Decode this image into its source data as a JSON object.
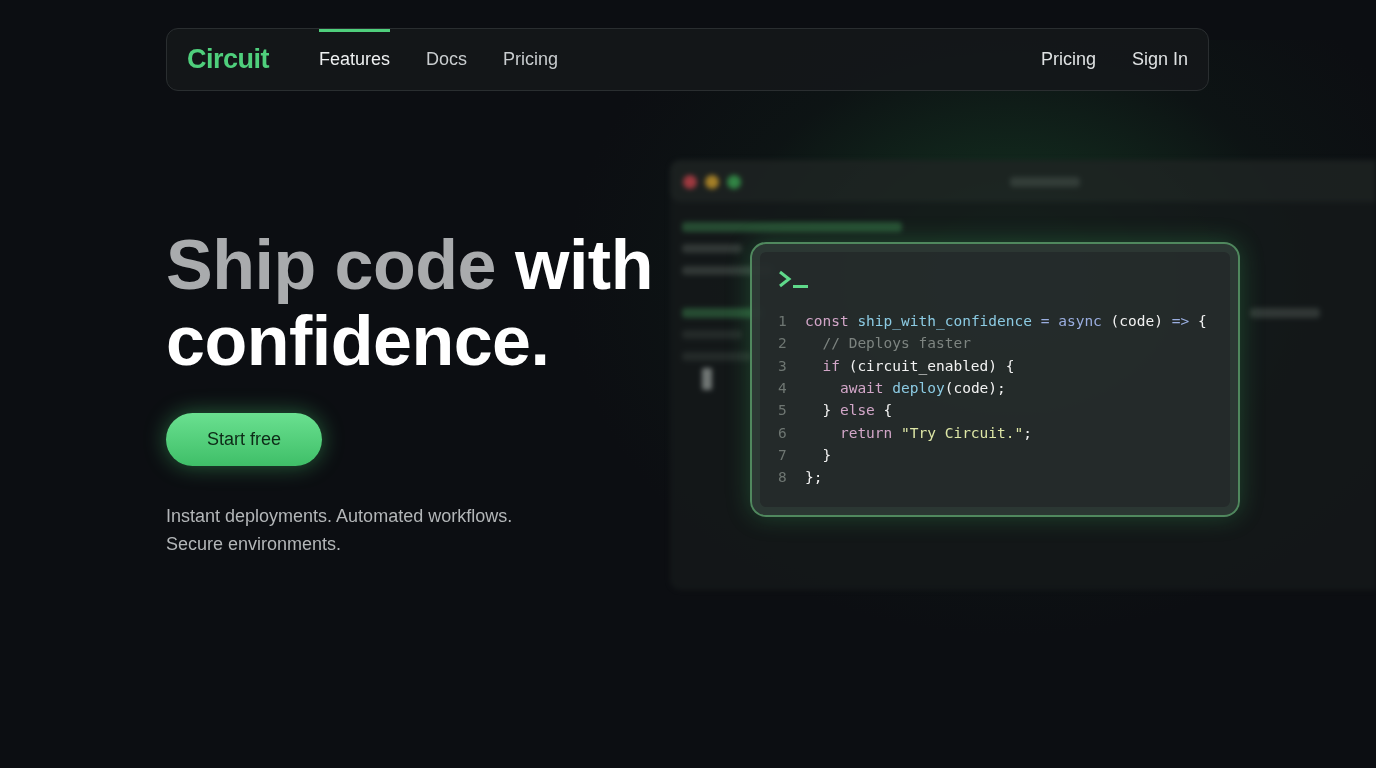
{
  "nav": {
    "logo": "Circuit",
    "links": [
      {
        "label": "Features",
        "selected": true
      },
      {
        "label": "Docs",
        "selected": false
      },
      {
        "label": "Pricing",
        "selected": false
      }
    ],
    "actions": [
      "Pricing",
      "Sign In"
    ]
  },
  "hero": {
    "headline": [
      {
        "text": "Ship code",
        "emphasis": false
      },
      {
        "text": "with confidence.",
        "emphasis": true
      }
    ],
    "cta": "Start free",
    "subtext": "Instant deployments. Automated workflows. Secure environments."
  },
  "code_card": {
    "lines": [
      {
        "number": "1",
        "tokens": [
          {
            "text": "const ",
            "kind": "keyword"
          },
          {
            "text": "ship_with_confidence",
            "kind": "function"
          },
          {
            "text": " = ",
            "kind": "operator"
          },
          {
            "text": "async",
            "kind": "operator"
          },
          {
            "text": " (code) ",
            "kind": "plain"
          },
          {
            "text": "=>",
            "kind": "operator"
          },
          {
            "text": " {",
            "kind": "plain"
          }
        ]
      },
      {
        "number": "2",
        "tokens": [
          {
            "text": "  // Deploys faster",
            "kind": "comment"
          }
        ]
      },
      {
        "number": "3",
        "tokens": [
          {
            "text": "  if",
            "kind": "keyword"
          },
          {
            "text": " (circuit_enabled) {",
            "kind": "plain"
          }
        ]
      },
      {
        "number": "4",
        "tokens": [
          {
            "text": "    await ",
            "kind": "keyword"
          },
          {
            "text": "deploy",
            "kind": "function"
          },
          {
            "text": "(code);",
            "kind": "plain"
          }
        ]
      },
      {
        "number": "5",
        "tokens": [
          {
            "text": "  } ",
            "kind": "plain"
          },
          {
            "text": "else",
            "kind": "keyword"
          },
          {
            "text": " {",
            "kind": "plain"
          }
        ]
      },
      {
        "number": "6",
        "tokens": [
          {
            "text": "    return ",
            "kind": "keyword"
          },
          {
            "text": "\"Try Circuit.\"",
            "kind": "string"
          },
          {
            "text": ";",
            "kind": "plain"
          }
        ]
      },
      {
        "number": "7",
        "tokens": [
          {
            "text": "  }",
            "kind": "plain"
          }
        ]
      },
      {
        "number": "8",
        "tokens": [
          {
            "text": "};",
            "kind": "plain"
          }
        ]
      }
    ]
  }
}
